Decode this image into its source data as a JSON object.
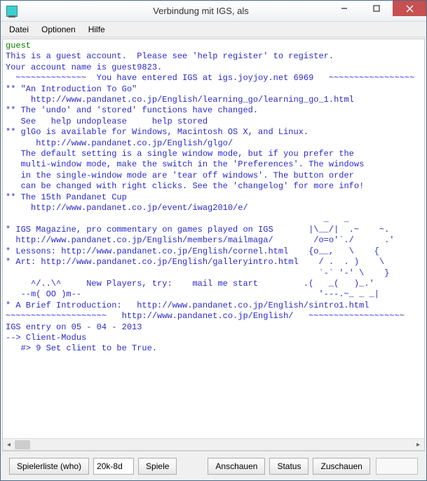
{
  "window": {
    "title": "Verbindung mit IGS, als"
  },
  "menu": {
    "file": "Datei",
    "options": "Optionen",
    "help": "Hilfe"
  },
  "terminal": {
    "user": "guest",
    "l1": "This is a guest account.  Please see 'help register' to register.",
    "l2": "Your account name is guest9823.",
    "l3": "  ~~~~~~~~~~~~~~  You have entered IGS at igs.joyjoy.net 6969   ~~~~~~~~~~~~~~~~~",
    "l4": "** \"An Introduction To Go\"",
    "l5": "     http://www.pandanet.co.jp/English/learning_go/learning_go_1.html",
    "l6": "** The 'undo' and 'stored' functions have changed.",
    "l7": "   See   help undoplease     help stored",
    "l8": "** glGo is available for Windows, Macintosh OS X, and Linux.",
    "l9": "      http://www.pandanet.co.jp/English/glgo/",
    "l10": "   The default setting is a single window mode, but if you prefer the",
    "l11": "   multi-window mode, make the switch in the 'Preferences'. The windows",
    "l12": "   in the single-window mode are 'tear off windows'. The button order",
    "l13": "   can be changed with right clicks. See the 'changelog' for more info!",
    "l14": "** The 15th Pandanet Cup",
    "l15": "     http://www.pandanet.co.jp/event/iwag2010/e/",
    "l16": "                                                               _   _",
    "l17": "* IGS Magazine, pro commentary on games played on IGS       |\\__/|  .~    ~.",
    "l18": "  http://www.pandanet.co.jp/English/members/mailmaga/        /o=o'`./      .'",
    "l19": "* Lessons: http://www.pandanet.co.jp/English/cornel.html    {o__,   \\    {",
    "l20": "* Art: http://www.pandanet.co.jp/English/galleryintro.html    / .  . )    \\",
    "l21": "                                                              `-` '-' \\    }",
    "l22": "     ^/..\\^     New Players, try:    mail me start         .(   _(   )_.'",
    "l23": "   --m( OO )m--                                               '---.~_ _ _|",
    "l24": "* A Brief Introduction:   http://www.pandanet.co.jp/English/sintro1.html",
    "l25": "~~~~~~~~~~~~~~~~~~~~   http://www.pandanet.co.jp/English/   ~~~~~~~~~~~~~~~~~~~",
    "l26": "IGS entry on 05 - 04 - 2013",
    "l27": "--> Client-Modus",
    "l28": "   #> 9 Set client to be True."
  },
  "toolbar": {
    "playerlist": "Spielerliste (who)",
    "rank": "20k-8d",
    "games": "Spiele",
    "observe": "Anschauen",
    "status": "Status",
    "watch": "Zuschauen",
    "input": ""
  }
}
